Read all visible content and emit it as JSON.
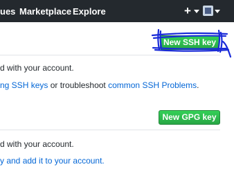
{
  "header": {
    "nav": [
      "ues",
      "Marketplace",
      "Explore"
    ],
    "plus": "+",
    "icons": {
      "plus": "plus-icon",
      "caret": "chevron-down-icon",
      "avatar": "avatar"
    }
  },
  "ssh": {
    "button": "New SSH key",
    "line1": "d with your account.",
    "line2_link1": "ng SSH keys",
    "line2_mid": " or troubleshoot ",
    "line2_link2": "common SSH Problems",
    "line2_end": "."
  },
  "gpg": {
    "button": "New GPG key",
    "line1": "d with your account.",
    "line2_link": "y and add it to your account."
  },
  "colors": {
    "header_bg": "#24292e",
    "button_green": "#28a745",
    "link": "#0366d6",
    "annotation": "#1a2bd8"
  }
}
